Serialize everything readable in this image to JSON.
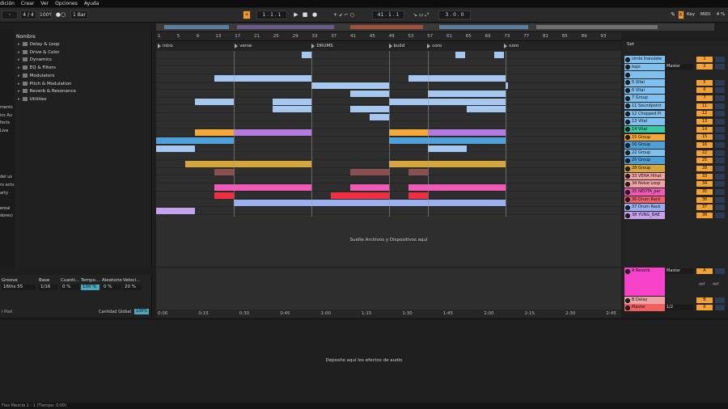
{
  "menu": [
    "dición",
    "Crear",
    "Ver",
    "Opciones",
    "Ayuda"
  ],
  "transport": {
    "signature": "4 / 4",
    "zoom": "100%",
    "quantize": "1 Bar",
    "position": "1 .  1 .  1",
    "loop_start": "41 .  1 .  1",
    "loop_length": "3 .  0 .  0",
    "key_label": "Key",
    "midi_label": "MIDI",
    "cpu": "4 %"
  },
  "browser": {
    "search": "Todo (Ctrl + F)",
    "header": "Nombre",
    "left_items": [
      "ments",
      "ics Au",
      "fects",
      "Live",
      "",
      "",
      "",
      "",
      "",
      "del us",
      "ro actu",
      "arty",
      "",
      "ereal",
      "dores)"
    ],
    "items": [
      "Delay & Loop",
      "Drive & Color",
      "Dynamics",
      "EQ & Filters",
      "Modulators",
      "Pitch & Modulation",
      "Reverb & Resonance",
      "Utilities"
    ]
  },
  "groove": {
    "headers": [
      "Groove",
      "Base",
      "Cuanti…",
      "Tempo…",
      "Aleatorio",
      "Veloci…"
    ],
    "values": [
      "16ths 55",
      "1/16",
      "0 %",
      "100 %",
      "0 %",
      "20 %"
    ],
    "pool": "l Pool",
    "global_label": "Cantidad Global",
    "global_value": "100%"
  },
  "ruler": {
    "bars": [
      "1",
      "5",
      "9",
      "13",
      "17",
      "21",
      "25",
      "29",
      "33",
      "37",
      "41",
      "45",
      "49",
      "53",
      "57",
      "61",
      "65",
      "69",
      "73",
      "77",
      "81",
      "85",
      "89",
      "93"
    ]
  },
  "locators": [
    {
      "label": "intro",
      "bar": 1
    },
    {
      "label": "verse",
      "bar": 17
    },
    {
      "label": "DRUMS",
      "bar": 33
    },
    {
      "label": "build",
      "bar": 49
    },
    {
      "label": "coro",
      "bar": 57
    },
    {
      "label": "coro",
      "bar": 73
    }
  ],
  "timebar": [
    "0:00",
    "0:15",
    "0:30",
    "0:45",
    "1:00",
    "1:15",
    "1:30",
    "1:45",
    "2:00",
    "2:15",
    "2:30",
    "2:45"
  ],
  "drop_text": "Suelte Archivos y Dispositivos aquí",
  "device_drop_text": "Deposite aquí los efectos de audio",
  "mixer": {
    "set_label": "Set",
    "route_master": "Master",
    "tracks": [
      {
        "name": "simle translate",
        "num": "1",
        "color": "#7fc0ef"
      },
      {
        "name": "bajo",
        "num": "2",
        "color": "#7fc0ef"
      },
      {
        "name": "",
        "num": "",
        "color": "#7fc0ef"
      },
      {
        "name": "5 Vital",
        "num": "5",
        "color": "#7fc0ef"
      },
      {
        "name": "6 Vital",
        "num": "6",
        "color": "#7fc0ef"
      },
      {
        "name": "7 Group",
        "num": "7",
        "color": "#7fc0ef"
      },
      {
        "name": "11 Soundpoint",
        "num": "11",
        "color": "#7fc0ef"
      },
      {
        "name": "12 Chopped Pi",
        "num": "12",
        "color": "#7fc0ef"
      },
      {
        "name": "13 Vital",
        "num": "13",
        "color": "#7fc0ef"
      },
      {
        "name": "14 Vital",
        "num": "14",
        "color": "#3cc8a0"
      },
      {
        "name": "15 Group",
        "num": "15",
        "color": "#f3a83a"
      },
      {
        "name": "16 Group",
        "num": "16",
        "color": "#4fa0d8"
      },
      {
        "name": "22 Group",
        "num": "22",
        "color": "#7fc0ef"
      },
      {
        "name": "25 Group",
        "num": "25",
        "color": "#4fa0d8"
      },
      {
        "name": "28 Group",
        "num": "28",
        "color": "#d7a63a"
      },
      {
        "name": "33 VEHA Hihat",
        "num": "33",
        "color": "#f0a3a3"
      },
      {
        "name": "34 Noise Loop",
        "num": "34",
        "color": "#f0a3a3"
      },
      {
        "name": "35 NEOTA_par",
        "num": "35",
        "color": "#ef5ab4"
      },
      {
        "name": "36 Drum Rack",
        "num": "36",
        "color": "#f06070"
      },
      {
        "name": "37 Drum Rack",
        "num": "37",
        "color": "#9ab0f0"
      },
      {
        "name": "38 YUNG_BAE",
        "num": "38",
        "color": "#c8a0f0"
      }
    ],
    "returns": [
      {
        "name": "A Reverb",
        "num": "A",
        "color": "#f542c8"
      },
      {
        "name": "B Delay",
        "num": "B",
        "color": "#f0a3a3"
      },
      {
        "name": "Master",
        "num": "0",
        "color": "#f06060"
      }
    ],
    "return_route": "Master",
    "master_route": "1/2",
    "inf_left": "-inf",
    "inf_right": "-inf"
  },
  "status_text": "Flex Mezcla 1 : 1   (Tiempo: 0:00)"
}
